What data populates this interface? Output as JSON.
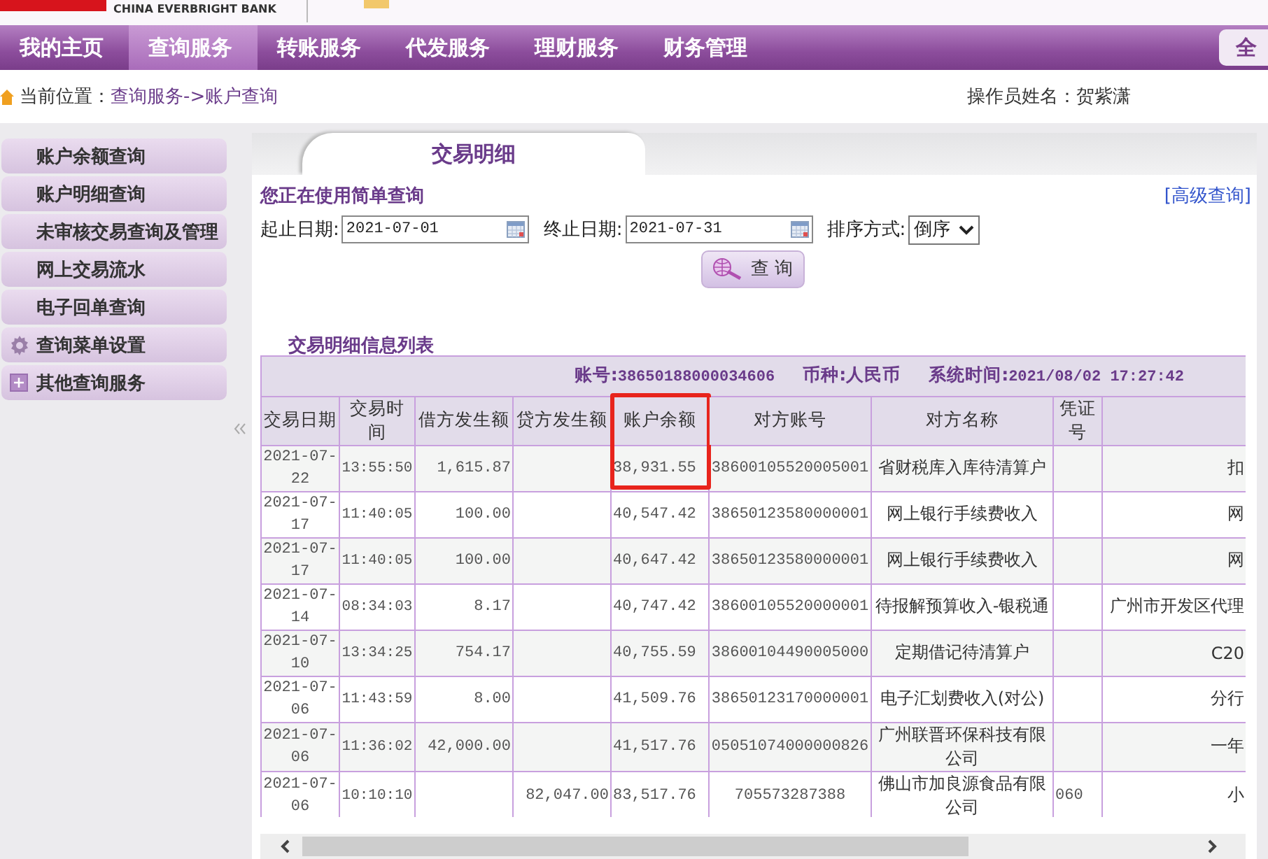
{
  "header": {
    "bank_name": "CHINA EVERBRIGHT BANK"
  },
  "nav": {
    "items": [
      {
        "label": "我的主页",
        "selected": false
      },
      {
        "label": "查询服务",
        "selected": true
      },
      {
        "label": "转账服务",
        "selected": false
      },
      {
        "label": "代发服务",
        "selected": false
      },
      {
        "label": "理财服务",
        "selected": false
      },
      {
        "label": "财务管理",
        "selected": false
      }
    ],
    "right_button": "全"
  },
  "breadcrumb": {
    "label": "当前位置：",
    "path": "查询服务->账户查询",
    "operator": "操作员姓名：贺紫潇"
  },
  "sidebar": {
    "items": [
      {
        "label": "账户余额查询",
        "kind": "plain"
      },
      {
        "label": "账户明细查询",
        "kind": "plain"
      },
      {
        "label": "未审核交易查询及管理",
        "kind": "plain"
      },
      {
        "label": "网上交易流水",
        "kind": "plain"
      },
      {
        "label": "电子回单查询",
        "kind": "plain"
      },
      {
        "label": "查询菜单设置",
        "kind": "gear"
      },
      {
        "label": "其他查询服务",
        "kind": "plus"
      }
    ]
  },
  "tab": {
    "label": "交易明细"
  },
  "query": {
    "title": "您正在使用简单查询",
    "advanced_link": "[高级查询]",
    "start_label": "起止日期:",
    "start_value": "2021-07-01",
    "end_label": "终止日期:",
    "end_value": "2021-07-31",
    "sort_label": "排序方式:",
    "sort_value": "倒序",
    "submit": "查 询"
  },
  "list_title": "交易明细信息列表",
  "info": {
    "account_label": "账号:",
    "account": "38650188000034606",
    "currency_label": "币种:人民币",
    "time_label": "系统时间:",
    "time": "2021/08/02 17:27:42"
  },
  "table": {
    "columns": [
      {
        "label": "交易日期",
        "highlighted": false
      },
      {
        "label": "交易时间",
        "highlighted": false
      },
      {
        "label": "借方发生额",
        "highlighted": false
      },
      {
        "label": "贷方发生额",
        "highlighted": false
      },
      {
        "label": "账户余额",
        "highlighted": true
      },
      {
        "label": "对方账号",
        "highlighted": false
      },
      {
        "label": "对方名称",
        "highlighted": false
      },
      {
        "label": "凭证号",
        "highlighted": false
      }
    ],
    "rows": [
      {
        "date": "2021-07-22",
        "time": "13:55:50",
        "debit": "1,615.87",
        "balance": "38,931.55",
        "account": "38600105520005001",
        "name": "省财税库入库待清算户",
        "column_9": "扣"
      },
      {
        "date": "2021-07-17",
        "time": "11:40:05",
        "debit": "100.00",
        "balance": "40,547.42",
        "account": "38650123580000001",
        "name": "网上银行手续费收入",
        "column_9": "网"
      },
      {
        "date": "2021-07-17",
        "time": "11:40:05",
        "debit": "100.00",
        "balance": "40,647.42",
        "account": "38650123580000001",
        "name": "网上银行手续费收入",
        "column_9": "网"
      },
      {
        "date": "2021-07-14",
        "time": "08:34:03",
        "debit": "8.17",
        "balance": "40,747.42",
        "account": "38600105520000001",
        "name": "待报解预算收入-银税通",
        "column_9": "广州市开发区代理"
      },
      {
        "date": "2021-07-10",
        "time": "13:34:25",
        "debit": "754.17",
        "balance": "40,755.59",
        "account": "38600104490005000",
        "name": "定期借记待清算户",
        "column_9": "C20"
      },
      {
        "date": "2021-07-06",
        "time": "11:43:59",
        "debit": "8.00",
        "balance": "41,509.76",
        "account": "38650123170000001",
        "name": "电子汇划费收入(对公)",
        "column_9": "分行"
      },
      {
        "date": "2021-07-06",
        "time": "11:36:02",
        "debit": "42,000.00",
        "balance": "41,517.76",
        "account": "05051074000000826",
        "name": "广州联晋环保科技有限公司",
        "column_9": "一年"
      },
      {
        "date": "2021-07-06",
        "time": "10:10:10",
        "credit": "82,047.00",
        "balance": "83,517.76",
        "account": "705573287388",
        "name": "佛山市加良源食品有限公司",
        "voucher": "060",
        "column_9": "小"
      }
    ]
  }
}
